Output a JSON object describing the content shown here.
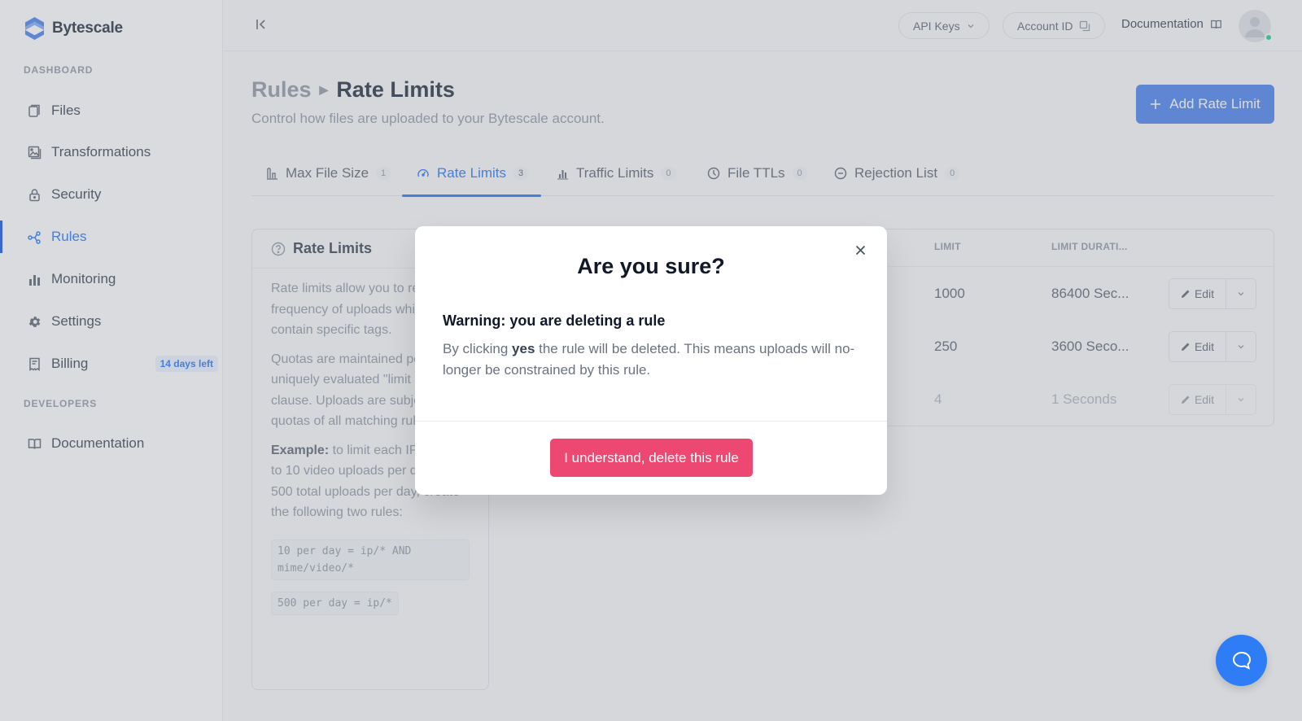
{
  "brand": {
    "name": "Bytescale",
    "accent": "#3b82f6"
  },
  "sidebar": {
    "sections": [
      {
        "label": "DASHBOARD"
      },
      {
        "label": "DEVELOPERS"
      }
    ],
    "items": [
      {
        "label": "Files",
        "icon": "files-icon"
      },
      {
        "label": "Transformations",
        "icon": "image-icon"
      },
      {
        "label": "Security",
        "icon": "lock-icon"
      },
      {
        "label": "Rules",
        "icon": "share-nodes-icon",
        "active": true
      },
      {
        "label": "Monitoring",
        "icon": "bar-chart-icon"
      },
      {
        "label": "Settings",
        "icon": "gear-icon"
      },
      {
        "label": "Billing",
        "icon": "receipt-icon",
        "badge": "14 days left"
      },
      {
        "label": "Documentation",
        "icon": "book-icon"
      }
    ]
  },
  "topbar": {
    "api_keys_label": "API Keys",
    "account_id_label": "Account ID",
    "documentation_label": "Documentation"
  },
  "header": {
    "breadcrumb_parent": "Rules",
    "breadcrumb_current": "Rate Limits",
    "subtitle": "Control how files are uploaded to your Bytescale account.",
    "add_button_label": "Add Rate Limit"
  },
  "tabs": [
    {
      "label": "Max File Size",
      "count": "1",
      "icon": "file-size-icon"
    },
    {
      "label": "Rate Limits",
      "count": "3",
      "icon": "gauge-icon",
      "active": true
    },
    {
      "label": "Traffic Limits",
      "count": "0",
      "icon": "bar-chart-icon"
    },
    {
      "label": "File TTLs",
      "count": "0",
      "icon": "clock-icon"
    },
    {
      "label": "Rejection List",
      "count": "0",
      "icon": "minus-circle-icon"
    }
  ],
  "info_card": {
    "title": "Rate Limits",
    "para1": "Rate limits allow you to restrict the frequency of uploads which contain specific tags.",
    "para2": "Quotas are maintained per uniquely evaluated \"limit per\" clause. Uploads are subject to the quotas of all matching rules.",
    "example_label": "Example:",
    "example_text": " to limit each IP address to 10 video uploads per day and 500 total uploads per day, create the following two rules:",
    "code1": "10 per day  = ip/* AND mime/video/*",
    "code2": "500 per day = ip/*"
  },
  "table": {
    "columns": [
      "LIMIT",
      "LIMIT DURATI..."
    ],
    "rows": [
      {
        "limit": "1000",
        "duration": "86400 Sec...",
        "edit_label": "Edit"
      },
      {
        "limit": "250",
        "duration": "3600 Seco...",
        "edit_label": "Edit"
      },
      {
        "limit": "4",
        "duration": "1 Seconds",
        "edit_label": "Edit"
      }
    ]
  },
  "modal": {
    "title": "Are you sure?",
    "warning": "Warning: you are deleting a rule",
    "text_before": "By clicking ",
    "text_bold": "yes",
    "text_after": " the rule will be deleted. This means uploads will no-longer be constrained by this rule.",
    "confirm_label": "I understand, delete this rule",
    "confirm_color": "#ec4872"
  }
}
